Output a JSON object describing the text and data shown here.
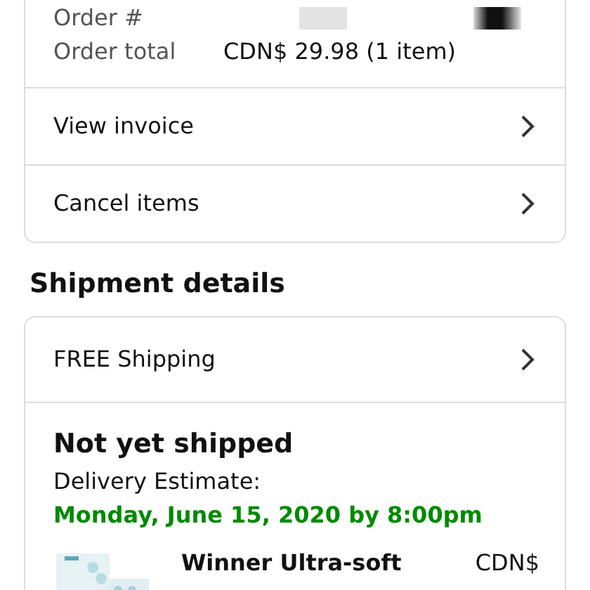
{
  "order_summary": {
    "rows": [
      {
        "label": "Order #",
        "kind": "redacted"
      },
      {
        "label": "Order total",
        "value": "CDN$ 29.98 (1 item)",
        "kind": "text"
      }
    ]
  },
  "order_actions": [
    {
      "label": "View invoice"
    },
    {
      "label": "Cancel items"
    }
  ],
  "shipment": {
    "heading": "Shipment details",
    "shipping_option": "FREE Shipping",
    "status": "Not yet shipped",
    "estimate_label": "Delivery Estimate:",
    "estimate_date": "Monday, June 15, 2020 by 8:00pm",
    "item": {
      "title": "Winner Ultra-soft",
      "price": "CDN$"
    }
  }
}
